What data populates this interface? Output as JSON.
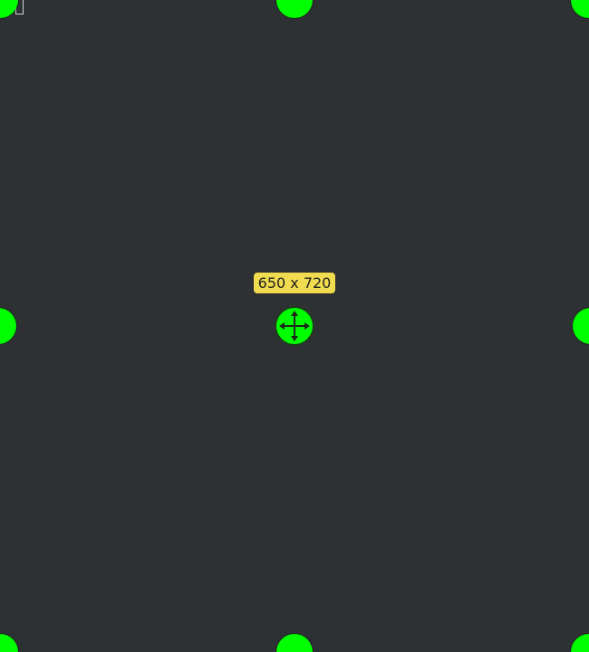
{
  "selection": {
    "size_label": "650 x 720",
    "handle_color": "#00ff00",
    "label_background": "#f0dc4e",
    "background_color": "#2e3134"
  },
  "icons": {
    "center": "move-arrows-icon",
    "resize": "resize-handle"
  }
}
